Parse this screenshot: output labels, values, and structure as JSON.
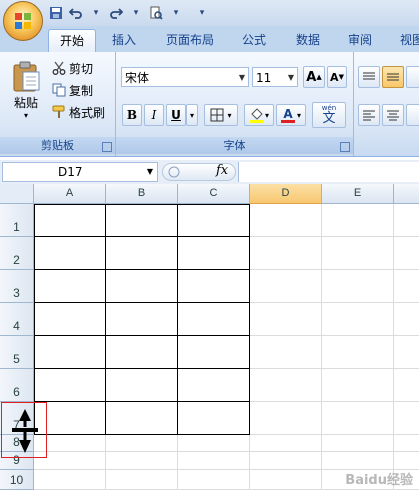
{
  "ribbon": {
    "tabs": [
      "开始",
      "插入",
      "页面布局",
      "公式",
      "数据",
      "审阅",
      "视图"
    ],
    "active_tab": "开始",
    "clipboard": {
      "paste_label": "粘贴",
      "cut_label": "剪切",
      "copy_label": "复制",
      "format_painter_label": "格式刷",
      "group_label": "剪贴板"
    },
    "font": {
      "font_name": "宋体",
      "font_size": "11",
      "bold": "B",
      "italic": "I",
      "underline": "U",
      "grow_label": "A",
      "shrink_label": "A",
      "font_color_label": "A",
      "phonetic_label": "wén",
      "phonetic_char": "文",
      "group_label": "字体"
    }
  },
  "formula_bar": {
    "name_box": "D17",
    "fx_label": "fx",
    "value": ""
  },
  "sheet": {
    "columns": [
      "A",
      "B",
      "C",
      "D",
      "E"
    ],
    "selected_column": "D",
    "rows": [
      "1",
      "2",
      "3",
      "4",
      "5",
      "6",
      "7",
      "8",
      "9",
      "10"
    ]
  },
  "watermark": "Baidu经验",
  "colors": {
    "ribbon_bg": "#dbe7f6",
    "selection": "#f7c770",
    "highlight": "#e02020"
  }
}
